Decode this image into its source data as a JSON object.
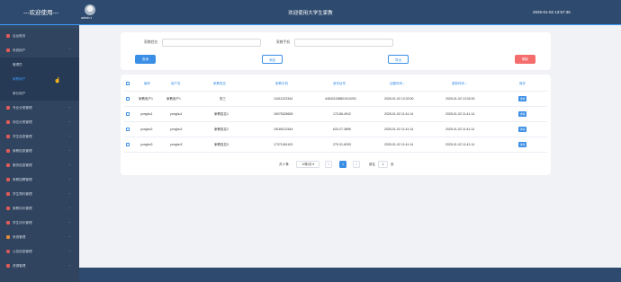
{
  "header": {
    "brand": "---欢迎使用---",
    "user": "admin",
    "welcome": "欢迎使用大学生家教",
    "clock": "2025-01-02 13:57:36"
  },
  "sidebar": {
    "items": [
      {
        "label": "后台首页",
        "icon": "home-icon",
        "expanded": false
      },
      {
        "label": "系统用户",
        "icon": "user-icon",
        "expanded": true
      },
      {
        "label": "专业分类管理",
        "icon": "grid-icon",
        "expanded": false
      },
      {
        "label": "岗位分类管理",
        "icon": "grid-icon",
        "expanded": false
      },
      {
        "label": "学生信息管理",
        "icon": "grid-icon",
        "expanded": false
      },
      {
        "label": "家教信息管理",
        "icon": "grid-icon",
        "expanded": false
      },
      {
        "label": "服务信息管理",
        "icon": "grid-icon",
        "expanded": false
      },
      {
        "label": "家教招聘管理",
        "icon": "grid-icon",
        "expanded": false
      },
      {
        "label": "学生预约管理",
        "icon": "grid-icon",
        "expanded": false
      },
      {
        "label": "家教评价管理",
        "icon": "grid-icon",
        "expanded": false
      },
      {
        "label": "学生评价管理",
        "icon": "grid-icon",
        "expanded": false
      },
      {
        "label": "系统管理",
        "icon": "settings-icon",
        "expanded": false
      },
      {
        "label": "公告信息管理",
        "icon": "bell-icon",
        "expanded": false
      },
      {
        "label": "资源管理",
        "icon": "flag-icon",
        "expanded": false
      }
    ],
    "sub_items": [
      {
        "label": "管理员"
      },
      {
        "label": "家教用户"
      },
      {
        "label": "家长用户"
      }
    ]
  },
  "search": {
    "name_label": "家教姓名",
    "name_value": "",
    "phone_label": "家教手机",
    "phone_value": "",
    "search_btn": "查询",
    "add_btn": "添加",
    "export_btn": "导出",
    "delete_btn": "删除"
  },
  "table": {
    "columns": [
      "编号",
      "用户名",
      "家教姓名",
      "家教手机",
      "身份证号",
      "创建时间 ↕",
      "更新时间 ↕",
      "操作"
    ],
    "rows": [
      [
        "家教用户1",
        "家教用户1",
        "张三",
        "13411223344",
        "445421198801010202",
        "2025-01-02 13:32:00",
        "2025-01-02 13:32:00",
        "详情"
      ],
      [
        "yonghu1",
        "yonghu1",
        "家教姓名1",
        "15075328639",
        "173-86-4912",
        "2025-01-02 11:41:14",
        "2025-01-02 11:41:14",
        "详情"
      ],
      [
        "yonghu2",
        "yonghu2",
        "家教姓名2",
        "15180122444",
        "623-27-3895",
        "2025-01-02 11:41:14",
        "2025-01-02 11:41:14",
        "详情"
      ],
      [
        "yonghu3",
        "yonghu3",
        "家教姓名3",
        "17371061103",
        "279-31-6293",
        "2025-01-02 11:41:14",
        "2025-01-02 11:41:14",
        "详情"
      ]
    ]
  },
  "pagination": {
    "total": "共 4 条",
    "page_size": "10条/页",
    "prev": "‹",
    "current": "1",
    "next": "›",
    "goto_label": "前往",
    "goto_value": "1",
    "page_suffix": "页"
  },
  "colors": {
    "header_bg": "#2e4a6e",
    "sidebar_bg": "#30445f",
    "primary": "#3a8ee6",
    "danger": "#f56c6c",
    "menu_icon": "#e05a5a"
  }
}
